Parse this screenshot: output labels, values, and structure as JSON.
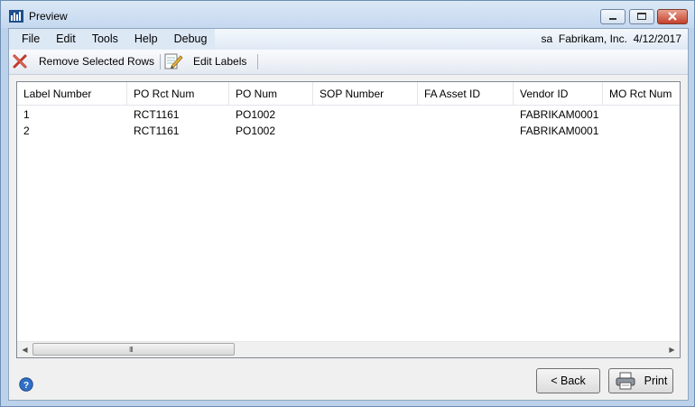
{
  "window": {
    "title": "Preview"
  },
  "menu": [
    "File",
    "Edit",
    "Tools",
    "Help",
    "Debug"
  ],
  "status": {
    "user": "sa",
    "company": "Fabrikam, Inc.",
    "date": "4/12/2017"
  },
  "toolbar": {
    "remove_label": "Remove Selected Rows",
    "edit_label": "Edit Labels"
  },
  "grid": {
    "columns": [
      "Label Number",
      "PO Rct Num",
      "PO Num",
      "SOP Number",
      "FA Asset ID",
      "Vendor ID",
      "MO Rct Num"
    ],
    "rows": [
      [
        "1",
        "RCT1161",
        "PO1002",
        "",
        "",
        "FABRIKAM0001",
        ""
      ],
      [
        "2",
        "RCT1161",
        "PO1002",
        "",
        "",
        "FABRIKAM0001",
        ""
      ]
    ],
    "scroll_grip": "III"
  },
  "buttons": {
    "back": "Back",
    "print": "Print"
  },
  "colors": {
    "title_bar": "#c4d8ef",
    "close_button": "#c3412b",
    "menu_bar": "#dde8f5"
  },
  "icons": {
    "app": "app-logo-icon",
    "remove": "red-x-icon",
    "edit": "notepad-pencil-icon",
    "help": "help-icon",
    "print": "printer-icon"
  }
}
